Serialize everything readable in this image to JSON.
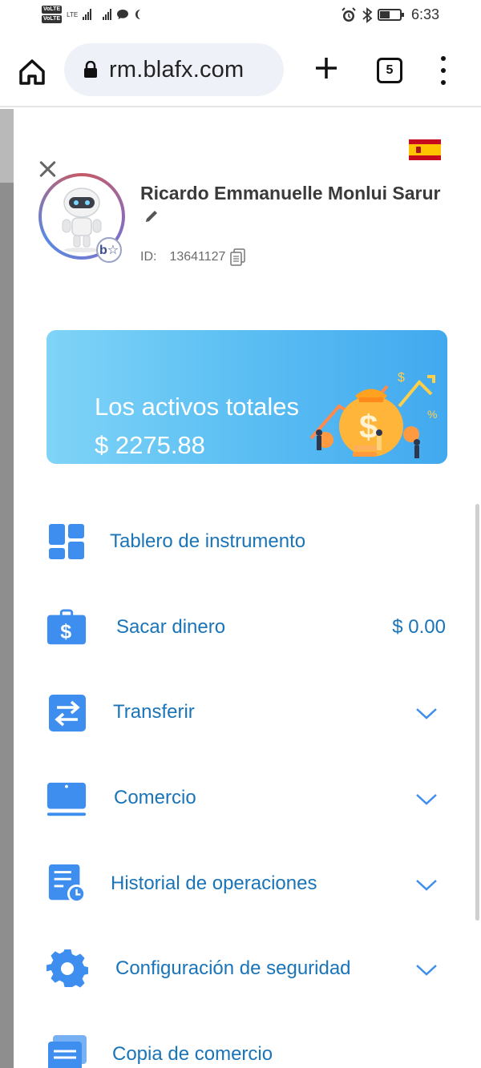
{
  "status_bar": {
    "volte_1": "VoLTE",
    "volte_2": "VoLTE",
    "network": "LTE",
    "time": "6:33",
    "icons": [
      "signal-icon",
      "signal-icon",
      "chat-icon",
      "moon-icon",
      "alarm-icon",
      "bluetooth-icon",
      "battery-icon"
    ]
  },
  "browser": {
    "url": "rm.blafx.com",
    "tab_count": "5",
    "icons": [
      "home-icon",
      "lock-icon",
      "plus-icon",
      "tabs-icon",
      "more-vert-icon"
    ]
  },
  "profile": {
    "name": "Ricardo Emmanuelle Monlui Sarur",
    "id_label": "ID:",
    "id_value": "13641127",
    "badge": "b☆",
    "flag": "spain-flag-icon"
  },
  "assets": {
    "title": "Los activos totales",
    "value": "$ 2275.88"
  },
  "menu": {
    "items": [
      {
        "label": "Tablero de instrumento",
        "icon": "dashboard-icon"
      },
      {
        "label": "Sacar dinero",
        "icon": "withdraw-icon",
        "value": "$ 0.00"
      },
      {
        "label": "Transferir",
        "icon": "transfer-icon"
      },
      {
        "label": "Comercio",
        "icon": "laptop-icon"
      },
      {
        "label": "Historial de operaciones",
        "icon": "history-icon"
      },
      {
        "label": "Configuración de seguridad",
        "icon": "gear-icon"
      },
      {
        "label": "Copia de comercio",
        "icon": "copy-trade-icon"
      }
    ]
  },
  "colors": {
    "accent": "#1a74b8",
    "icon_blue": "#3e8ef0",
    "card_start": "#7fd4f7",
    "card_end": "#42a9ef"
  }
}
